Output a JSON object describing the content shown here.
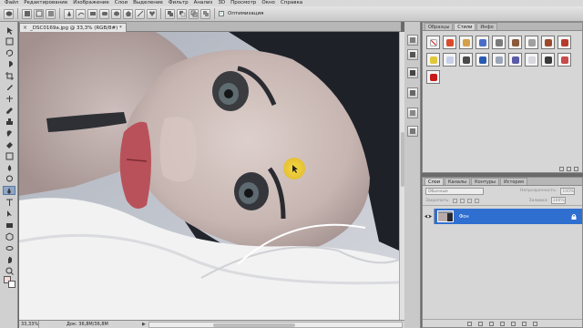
{
  "menu": [
    "Файл",
    "Редактирование",
    "Изображение",
    "Слои",
    "Выделение",
    "Фильтр",
    "Анализ",
    "3D",
    "Просмотр",
    "Окно",
    "Справка"
  ],
  "options_bar": {
    "antialias_label": "Оптимизация",
    "antialias_checked": true
  },
  "document": {
    "tab_title": "_DSC0169a.jpg @ 33,3% (RGB/8#) *",
    "close_glyph": "×"
  },
  "status": {
    "zoom": "33,33%",
    "doc_size": "Док: 36,8M/36,8M",
    "arrow": "▶"
  },
  "styles_panel": {
    "tabs": [
      "Образцы",
      "Стили",
      "Инфо"
    ],
    "active_tab": "Стили"
  },
  "layers_panel": {
    "tabs": [
      "Слои",
      "Каналы",
      "Контуры",
      "История"
    ],
    "active_tab": "Слои",
    "blend_mode": "Обычные",
    "opacity_label": "Непрозрачность:",
    "opacity": "100%",
    "lock_label": "Закрепить:",
    "fill_label": "Заливка:",
    "fill": "100%",
    "layer_name": "Фон"
  },
  "colors": {
    "foreground": "#f4dcdc",
    "background": "#ffffff",
    "layer_selected": "#2f6fd0",
    "cursor_highlight": "#f2d02a"
  },
  "tools": [
    "move-icon",
    "marquee-icon",
    "lasso-icon",
    "quick-select-icon",
    "crop-icon",
    "eyedropper-icon",
    "healing-icon",
    "brush-icon",
    "clone-stamp-icon",
    "history-brush-icon",
    "eraser-icon",
    "gradient-icon",
    "blur-icon",
    "dodge-icon",
    "pen-icon",
    "type-icon",
    "path-select-icon",
    "shape-icon",
    "3d-rotate-icon",
    "3d-orbit-icon",
    "hand-icon",
    "zoom-icon"
  ]
}
